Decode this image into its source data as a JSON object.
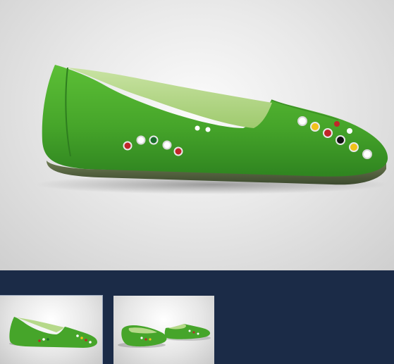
{
  "gallery": {
    "main_image": {
      "subject": "shoe-image",
      "color": "#4aa62a"
    },
    "thumbnails": [
      {
        "name": "thumbnail-side-view",
        "selected": true
      },
      {
        "name": "thumbnail-pair-view",
        "selected": false
      }
    ],
    "strip_background": "#1b2b47",
    "eyelet_colors": [
      "#c0262a",
      "#ffffff",
      "#1a6f2a",
      "#f2c21a",
      "#111111"
    ]
  }
}
